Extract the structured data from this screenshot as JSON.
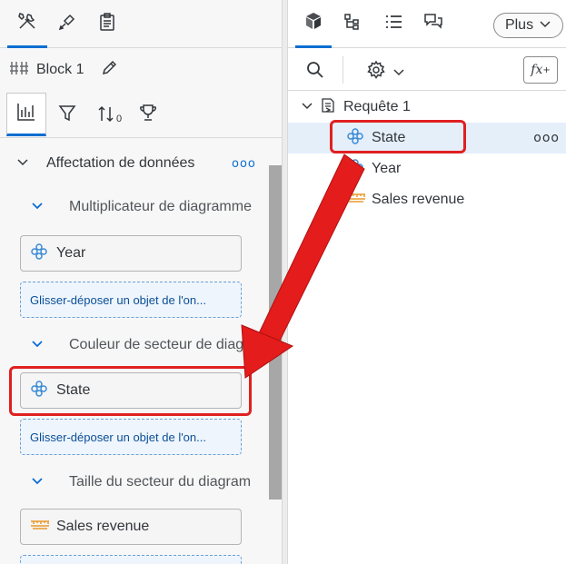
{
  "left_panel": {
    "top_tabs": [
      {
        "icon": "tools-icon",
        "active": true
      },
      {
        "icon": "format-brush-icon",
        "active": false
      },
      {
        "icon": "clipboard-icon",
        "active": false
      }
    ],
    "block_title": "Block 1",
    "sub_tabs": [
      {
        "icon": "chart-builder-icon",
        "active": true
      },
      {
        "icon": "filter-icon",
        "active": false
      },
      {
        "icon": "sort-icon",
        "active": false
      },
      {
        "icon": "trophy-icon",
        "active": false
      }
    ],
    "sort_subscript": "0",
    "section": {
      "title": "Affectation de données",
      "more": "ooo"
    },
    "subsections": [
      {
        "title": "Multiplicateur de diagramme",
        "objects": [
          {
            "label": "Year",
            "type": "dimension"
          }
        ],
        "drop_placeholder": "Glisser-déposer un objet de l'on..."
      },
      {
        "title": "Couleur de secteur de diagramme",
        "objects": [
          {
            "label": "State",
            "type": "dimension"
          }
        ],
        "drop_placeholder": "Glisser-déposer un objet de l'on..."
      },
      {
        "title": "Taille du secteur du diagramme",
        "objects": [
          {
            "label": "Sales revenue",
            "type": "measure"
          }
        ]
      }
    ]
  },
  "right_panel": {
    "tabs": [
      {
        "icon": "cube-icon",
        "active": true
      },
      {
        "icon": "hierarchy-icon",
        "active": false
      },
      {
        "icon": "list-icon",
        "active": false
      },
      {
        "icon": "comments-icon",
        "active": false
      }
    ],
    "plus_label": "Plus",
    "fx_label": "fx",
    "fx_sup": "+",
    "tree": {
      "query_label": "Requête 1",
      "items": [
        {
          "label": "State",
          "type": "dimension",
          "selected": true,
          "more": "ooo"
        },
        {
          "label": "Year",
          "type": "dimension",
          "selected": false
        },
        {
          "label": "Sales revenue",
          "type": "measure",
          "selected": false
        }
      ]
    }
  },
  "colors": {
    "accent": "#0a6ed1",
    "highlight": "#e02020",
    "dimension": "#3a8ad6",
    "measure": "#e89a2c"
  }
}
